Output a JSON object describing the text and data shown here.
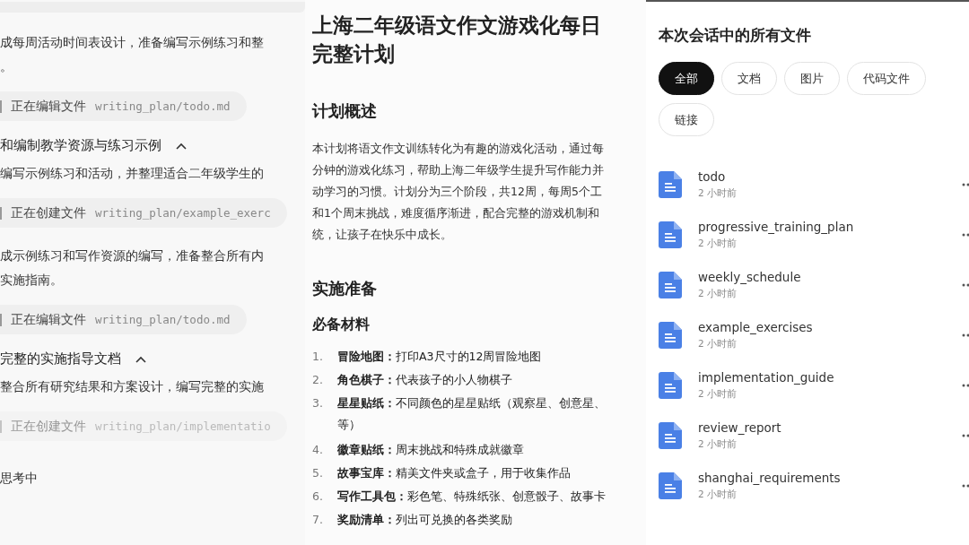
{
  "chat_log": [
    {
      "kind": "text",
      "lines": [
        "成每周活动时间表设计，准备编写示例练习和整",
        "。"
      ]
    },
    {
      "kind": "file_action",
      "action": "正在编辑文件",
      "path": "writing_plan/todo.md",
      "faded": false
    },
    {
      "kind": "step",
      "title": "和编制教学资源与练习示例",
      "expanded": true
    },
    {
      "kind": "text",
      "lines": [
        "编写示例练习和活动，并整理适合二年级学生的"
      ]
    },
    {
      "kind": "file_action",
      "action": "正在创建文件",
      "path": "writing_plan/example_exerc",
      "faded": false
    },
    {
      "kind": "text",
      "lines": [
        "成示例练习和写作资源的编写，准备整合所有内",
        "实施指南。"
      ]
    },
    {
      "kind": "file_action",
      "action": "正在编辑文件",
      "path": "writing_plan/todo.md",
      "faded": false
    },
    {
      "kind": "step",
      "title": "完整的实施指导文档",
      "expanded": true
    },
    {
      "kind": "text",
      "lines": [
        "整合所有研究结果和方案设计，编写完整的实施"
      ]
    },
    {
      "kind": "file_action",
      "action": "正在创建文件",
      "path": "writing_plan/implementatio",
      "faded": true
    },
    {
      "kind": "status",
      "lines": [
        "思考中"
      ]
    }
  ],
  "document": {
    "title_lines": [
      "上海二年级语文作文游戏化每日",
      "完整计划"
    ],
    "sections": [
      {
        "heading": "计划概述",
        "paragraph_lines": [
          "本计划将语文作文训练转化为有趣的游戏化活动，通过每",
          "分钟的游戏化练习，帮助上海二年级学生提升写作能力并",
          "动学习的习惯。计划分为三个阶段，共12周，每周5个工",
          "和1个周末挑战，难度循序渐进，配合完整的游戏机制和",
          "统，让孩子在快乐中成长。"
        ]
      },
      {
        "heading": "实施准备",
        "subheading": "必备材料",
        "list": [
          {
            "number": "1.",
            "term": "冒险地图：",
            "lines": [
              "打印A3尺寸的12周冒险地图"
            ]
          },
          {
            "number": "2.",
            "term": "角色棋子：",
            "lines": [
              "代表孩子的小人物棋子"
            ]
          },
          {
            "number": "3.",
            "term": "星星贴纸：",
            "lines": [
              "不同颜色的星星贴纸（观察星、创意星、",
              "等）"
            ]
          },
          {
            "number": "4.",
            "term": "徽章贴纸：",
            "lines": [
              "周末挑战和特殊成就徽章"
            ]
          },
          {
            "number": "5.",
            "term": "故事宝库：",
            "lines": [
              "精美文件夹或盒子，用于收集作品"
            ]
          },
          {
            "number": "6.",
            "term": "写作工具包：",
            "lines": [
              "彩色笔、特殊纸张、创意骰子、故事卡"
            ]
          },
          {
            "number": "7.",
            "term": "奖励清单：",
            "lines": [
              "列出可兑换的各类奖励"
            ]
          }
        ]
      }
    ]
  },
  "files_panel": {
    "title": "本次会话中的所有文件",
    "filters": [
      {
        "label": "全部",
        "selected": true
      },
      {
        "label": "文档",
        "selected": false
      },
      {
        "label": "图片",
        "selected": false
      },
      {
        "label": "代码文件",
        "selected": false
      },
      {
        "label": "链接",
        "selected": false
      }
    ],
    "files": [
      {
        "name": "todo",
        "time": "2 小时前"
      },
      {
        "name": "progressive_training_plan",
        "time": "2 小时前"
      },
      {
        "name": "weekly_schedule",
        "time": "2 小时前"
      },
      {
        "name": "example_exercises",
        "time": "2 小时前"
      },
      {
        "name": "implementation_guide",
        "time": "2 小时前"
      },
      {
        "name": "review_report",
        "time": "2 小时前"
      },
      {
        "name": "shanghai_requirements",
        "time": "2 小时前"
      }
    ]
  }
}
